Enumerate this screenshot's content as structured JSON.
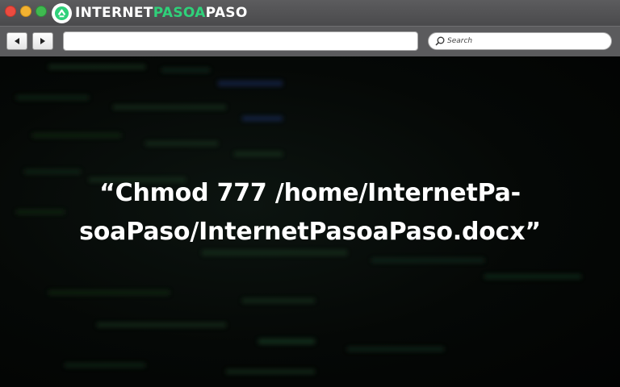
{
  "titlebar": {
    "brand_white_1": "INTERNET",
    "brand_green": "PASOA",
    "brand_white_2": "PASO"
  },
  "toolbar": {
    "back_icon": "left-arrow-icon",
    "forward_icon": "right-arrow-icon",
    "address_value": "",
    "search_placeholder": "Search"
  },
  "content": {
    "line1": "“Chmod 777 /home/InternetPa-",
    "line2": "soaPaso/InternetPasoaPaso.docx”"
  },
  "colors": {
    "close": "#ec4b3f",
    "minimize": "#f2b231",
    "maximize": "#3fb950",
    "brand_green": "#2fd17a",
    "chrome": "#5b5b5d"
  }
}
